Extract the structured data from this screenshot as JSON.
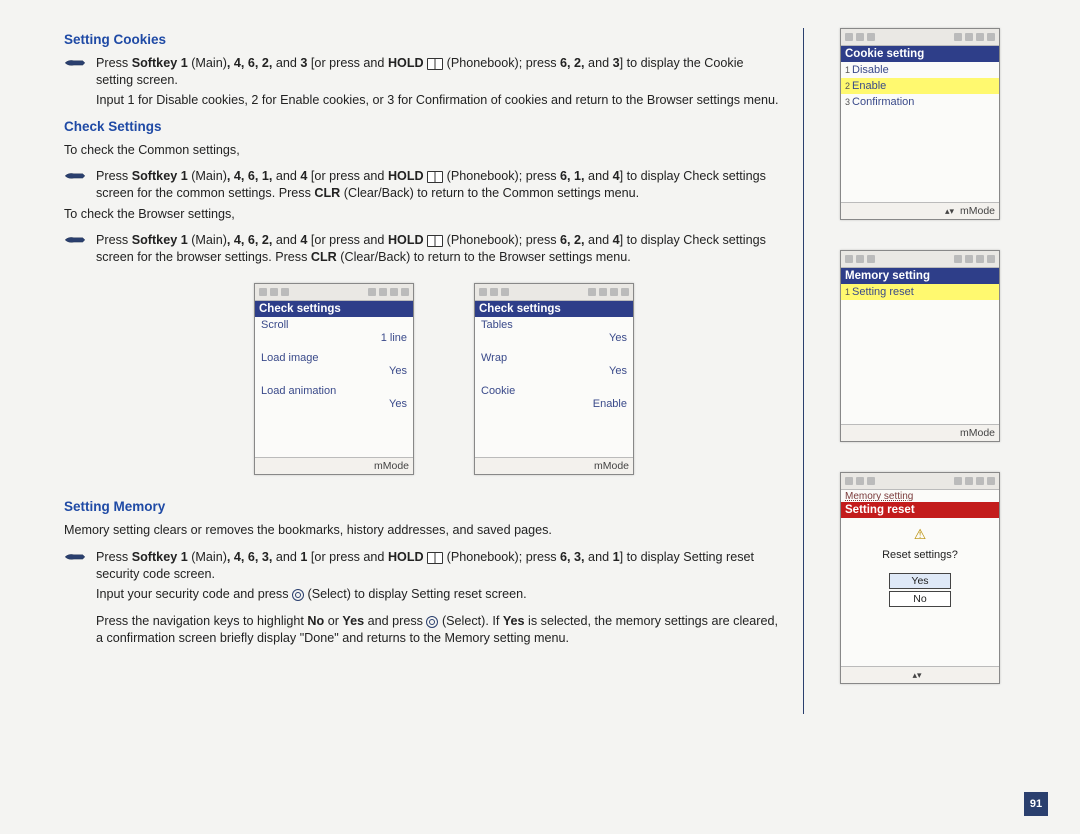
{
  "sections": {
    "s1_title": "Setting Cookies",
    "s1_bullet": "Press Softkey 1 (Main), 4, 6, 2, and 3 [or press and HOLD (Phonebook); press 6, 2, and 3] to display the Cookie setting screen.",
    "s1_indent": "Input 1 for Disable cookies, 2 for Enable cookies, or 3 for Confirmation of cookies and return to the Browser settings menu.",
    "s2_title": "Check Settings",
    "s2_body1": "To check the Common settings,",
    "s2_bullet1": "Press Softkey 1 (Main), 4, 6, 1, and 4 [or press and HOLD (Phonebook); press 6, 1, and 4] to display Check settings screen for the common settings. Press CLR (Clear/Back) to return to the Common settings menu.",
    "s2_body2": "To check the Browser settings,",
    "s2_bullet2": "Press Softkey 1 (Main), 4, 6, 2, and 4 [or press and HOLD (Phonebook); press 6, 2, and 4] to display Check settings screen for the browser settings. Press CLR (Clear/Back) to return to the Browser settings menu.",
    "s3_title": "Setting Memory",
    "s3_body": "Memory setting clears or removes the bookmarks, history addresses, and saved pages.",
    "s3_bullet": "Press Softkey 1 (Main), 4, 6, 3, and 1 [or press and HOLD (Phonebook); press 6, 3, and 1] to display Setting reset security code screen.",
    "s3_indent1": "Input your security code and press (Select) to display Setting reset screen.",
    "s3_indent2": "Press the navigation keys to highlight No or Yes and press (Select). If Yes is selected, the memory settings are cleared, a confirmation screen briefly display \"Done\" and returns to the Memory setting menu."
  },
  "phones": {
    "check1": {
      "title": "Check settings",
      "rows": [
        {
          "k": "Scroll",
          "v": "1 line"
        },
        {
          "k": "Load image",
          "v": "Yes"
        },
        {
          "k": "Load animation",
          "v": "Yes"
        }
      ],
      "soft": "mMode"
    },
    "check2": {
      "title": "Check settings",
      "rows": [
        {
          "k": "Tables",
          "v": "Yes"
        },
        {
          "k": "Wrap",
          "v": "Yes"
        },
        {
          "k": "Cookie",
          "v": "Enable"
        }
      ],
      "soft": "mMode"
    },
    "cookie": {
      "title": "Cookie setting",
      "items": [
        "Disable",
        "Enable",
        "Confirmation"
      ],
      "highlight": 1,
      "soft": "mMode"
    },
    "memory": {
      "title": "Memory setting",
      "items": [
        "Setting reset"
      ],
      "highlight": 0,
      "soft": "mMode"
    },
    "reset": {
      "subheader": "Memory setting",
      "title": "Setting reset",
      "msg": "Reset settings?",
      "yes": "Yes",
      "no": "No"
    }
  },
  "page_number": "91"
}
